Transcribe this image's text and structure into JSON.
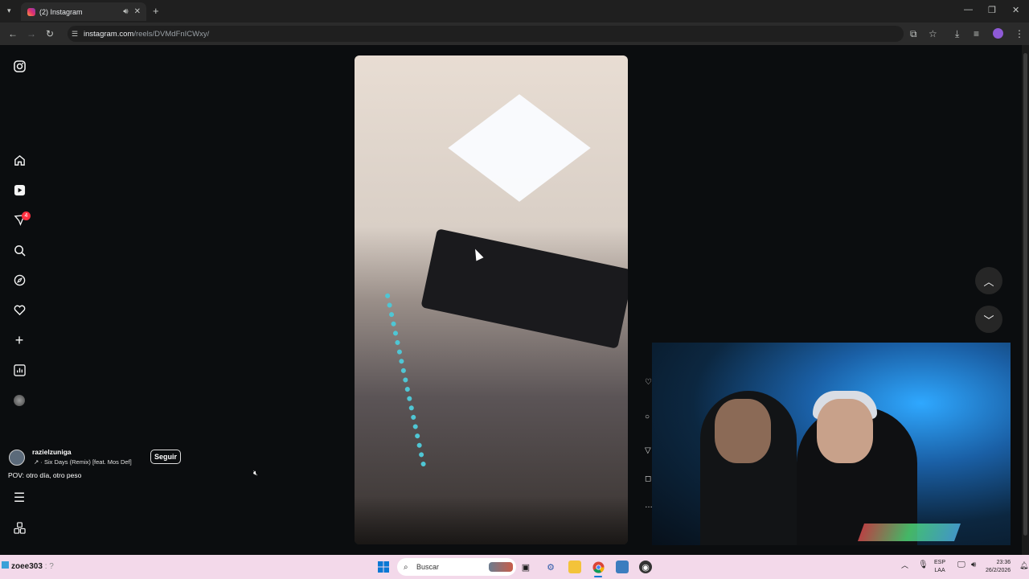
{
  "browser": {
    "tab_title": "(2) Instagram",
    "url_domain": "instagram.com",
    "url_path": "/reels/DVMdFnICWxy/"
  },
  "sidebar": {
    "notification_count": "4"
  },
  "reel": {
    "username": "razielzuniga",
    "song": "↗ · Six Days (Remix) [feat. Mos Def]",
    "follow_label": "Seguir",
    "caption": "POV: otro día, otro peso"
  },
  "taskbar": {
    "user_label": "zoee303",
    "search_placeholder": "Buscar",
    "lang_top": "ESP",
    "lang_bottom": "LAA",
    "time": "23:36",
    "date": "26/2/2026"
  }
}
